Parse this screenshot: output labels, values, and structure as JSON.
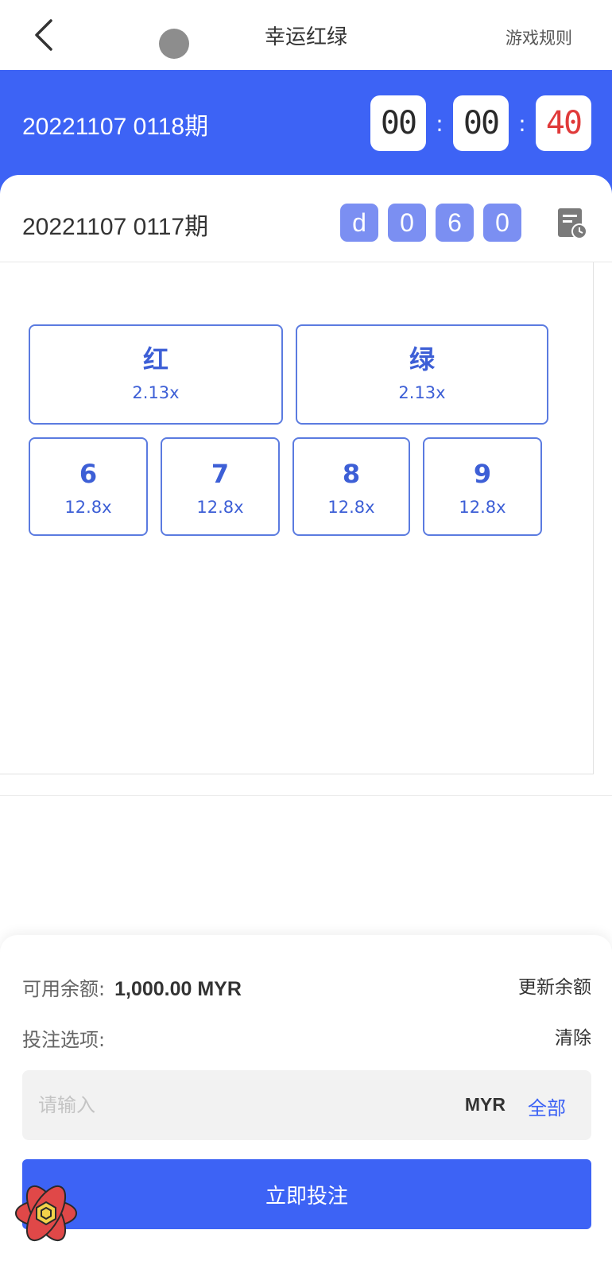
{
  "header": {
    "title": "幸运红绿",
    "rules_label": "游戏规则"
  },
  "current_period": {
    "label": "20221107 0118期",
    "countdown": [
      "00",
      "00",
      "40"
    ],
    "separator": ":"
  },
  "last_result": {
    "label": "20221107 0117期",
    "balls": [
      "d",
      "0",
      "6",
      "0"
    ]
  },
  "options": {
    "colors": [
      {
        "name": "红",
        "odds": "2.13x"
      },
      {
        "name": "绿",
        "odds": "2.13x"
      }
    ],
    "numbers": [
      {
        "name": "6",
        "odds": "12.8x"
      },
      {
        "name": "7",
        "odds": "12.8x"
      },
      {
        "name": "8",
        "odds": "12.8x"
      },
      {
        "name": "9",
        "odds": "12.8x"
      }
    ]
  },
  "bet_panel": {
    "balance_label": "可用余额:",
    "balance_value": "1,000.00 MYR",
    "refresh_label": "更新余额",
    "selection_label": "投注选项:",
    "clear_label": "清除",
    "amount_placeholder": "请输入",
    "amount_value": "",
    "currency": "MYR",
    "all_label": "全部",
    "submit_label": "立即投注"
  },
  "colors": {
    "primary": "#3d63f5",
    "option_border": "#5b7be0",
    "ball_bg": "#7b8ff2",
    "countdown_alert": "#e03a3a"
  }
}
